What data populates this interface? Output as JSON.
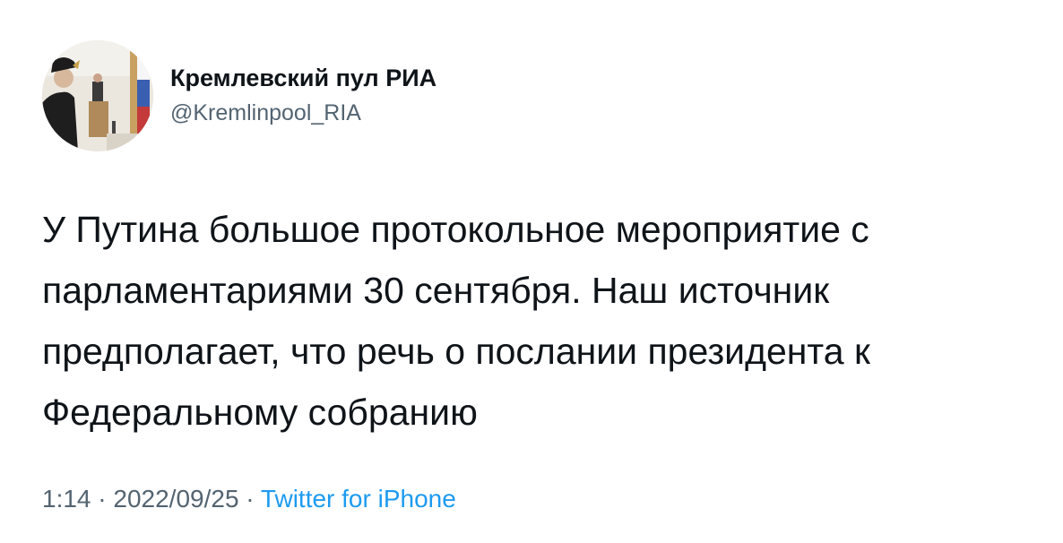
{
  "tweet": {
    "author": {
      "display_name": "Кремлевский пул РИА",
      "handle": "@Kremlinpool_RIA"
    },
    "text": "У Путина большое протокольное мероприятие с парламентариями 30 сентября. Наш источник предполагает, что речь о послании президента к Федеральному собранию",
    "time": "1:14",
    "separator": " · ",
    "date": "2022/09/25",
    "source": "Twitter for iPhone"
  },
  "colors": {
    "text": "#0f1419",
    "secondary": "#536471",
    "link": "#1d9bf0"
  }
}
